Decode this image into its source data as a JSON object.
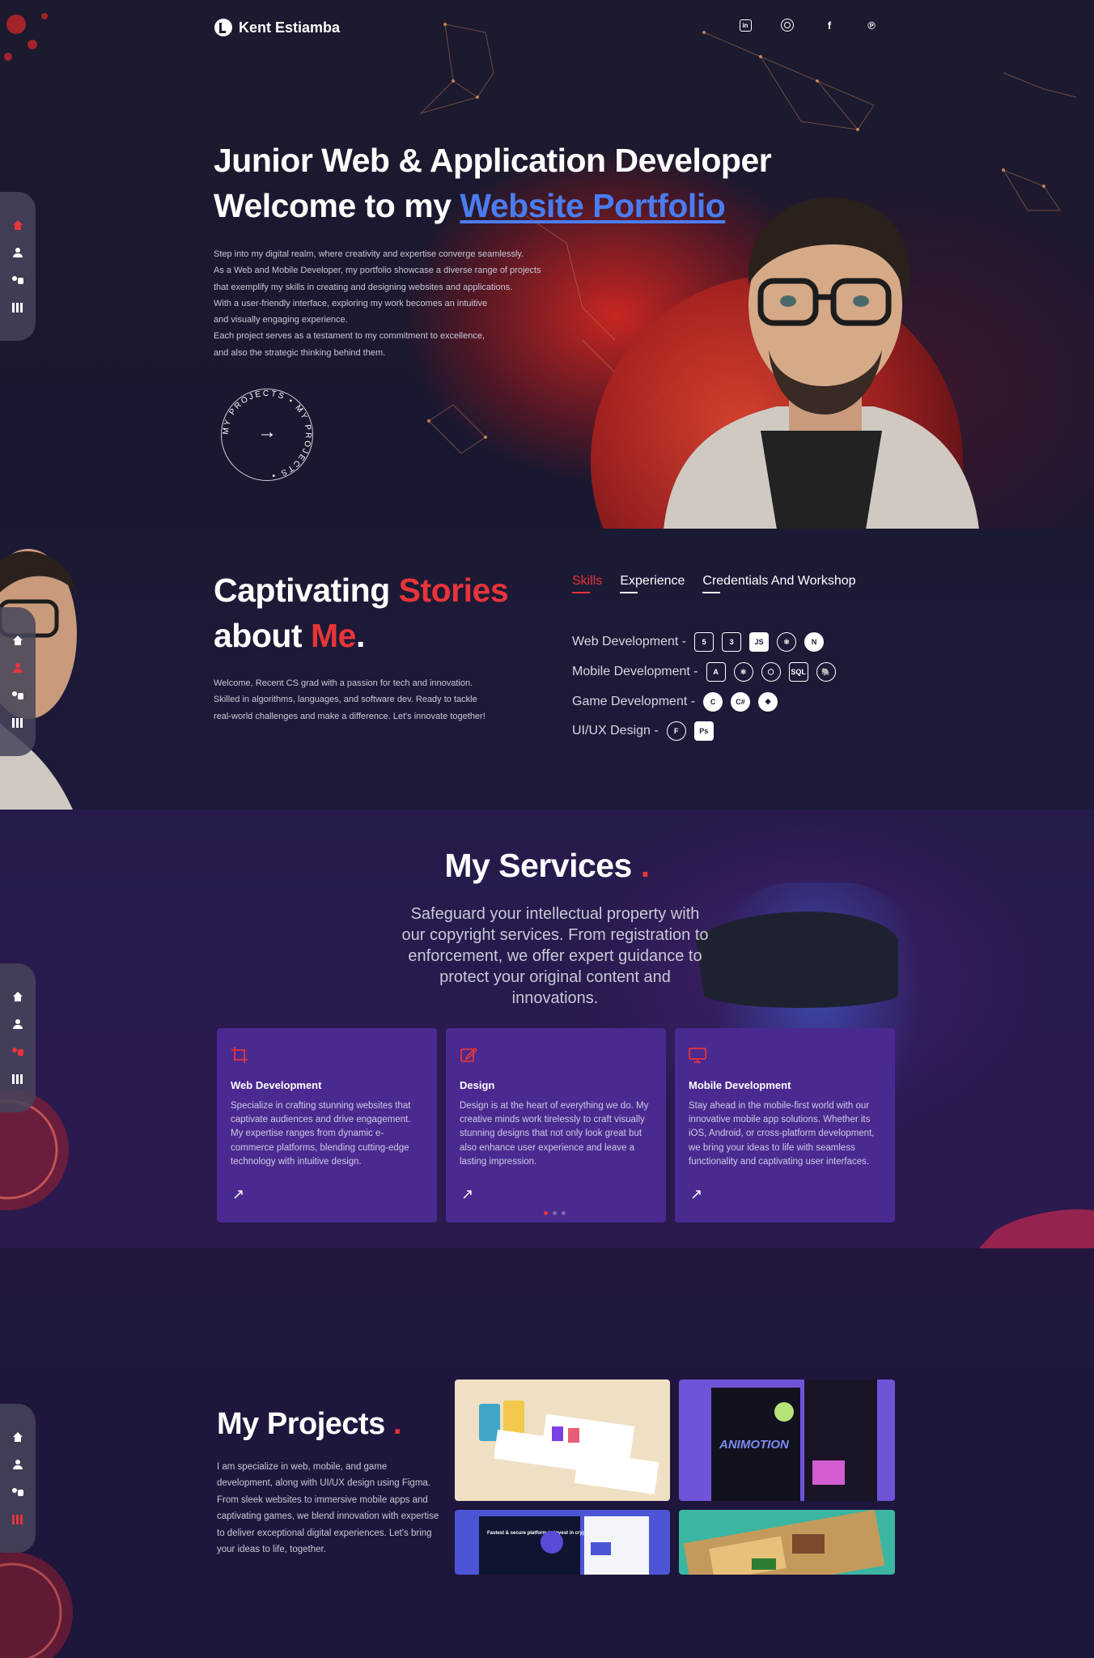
{
  "brand": {
    "name": "Kent Estiamba"
  },
  "socials": [
    {
      "icon": "linkedin-icon",
      "glyph": "in"
    },
    {
      "icon": "instagram-icon",
      "glyph": ""
    },
    {
      "icon": "facebook-icon",
      "glyph": "f"
    },
    {
      "icon": "pinterest-icon",
      "glyph": "℗"
    }
  ],
  "colors": {
    "accent": "#e8343a",
    "link": "#4a7cf0",
    "card": "#4a2a90"
  },
  "hero": {
    "title_line1": "Junior Web & Application Developer",
    "title_line2_prefix": "Welcome to my ",
    "title_line2_link": "Website Portfolio",
    "paragraph": [
      "Step into my digital realm, where creativity and expertise converge seamlessly.",
      "As a Web and Mobile Developer, my portfolio showcase a diverse range of projects",
      "that exemplify my skills in creating and designing websites and applications.",
      "With a user-friendly interface, exploring my work becomes an intuitive",
      "and visually engaging experience.",
      "Each project serves as a testament to my commitment to excellence,",
      "and also the strategic thinking behind them."
    ],
    "badge_text": "MY PROJECTS • MY PROJECTS •"
  },
  "about": {
    "title_a": "Captivating ",
    "title_b": "Stories",
    "title_c": "about ",
    "title_d": "Me",
    "title_e": ".",
    "paragraph": [
      "Welcome, Recent CS grad with a passion for tech and innovation.",
      "Skilled in algorithms, languages, and software dev. Ready to tackle",
      "real-world challenges and make a difference. Let's innovate together!"
    ],
    "tabs": [
      "Skills",
      "Experience",
      "Credentials And Workshop"
    ],
    "skills": [
      {
        "label": "Web Development -",
        "icons": [
          "5",
          "3",
          "JS",
          "⚛",
          "N"
        ]
      },
      {
        "label": "Mobile Development -",
        "icons": [
          "A",
          "⚛",
          "⬡",
          "SQL",
          "🐘"
        ]
      },
      {
        "label": "Game Development -",
        "icons": [
          "C",
          "C#",
          "◆"
        ]
      },
      {
        "label": "UI/UX Design -",
        "icons": [
          "F",
          "Ps"
        ]
      }
    ]
  },
  "services": {
    "title": "My Services",
    "title_dot": ".",
    "subtitle": "Safeguard your intellectual property with our copyright services. From registration to enforcement, we offer expert guidance to protect your original content and innovations.",
    "cards": [
      {
        "icon": "crop-icon",
        "title": "Web Development",
        "text": "Specialize in crafting stunning websites that captivate audiences and drive engagement. My expertise ranges from dynamic e-commerce platforms, blending cutting-edge technology with intuitive design."
      },
      {
        "icon": "edit-icon",
        "title": "Design",
        "text": "Design is at the heart of everything we do. My creative minds work tirelessly to craft visually stunning designs that not only look great but also enhance user experience and leave a lasting impression."
      },
      {
        "icon": "monitor-icon",
        "title": "Mobile Development",
        "text": "Stay ahead in the mobile-first world with our innovative mobile app solutions. Whether its iOS, Android, or cross-platform development, we bring your ideas to life with seamless functionality and captivating user interfaces."
      }
    ],
    "arrow": "↗"
  },
  "projects": {
    "title": "My Projects",
    "title_dot": ".",
    "paragraph": "I am specialize in web, mobile, and game development, along with UI/UX design using Figma. From sleek websites to immersive mobile apps and captivating games, we blend innovation with expertise to deliver exceptional digital experiences. Let's bring your ideas to life, together.",
    "thumb2_text": "ANIMOTION",
    "thumb3_text": "Fastest & secure platform to invest in crypto"
  }
}
